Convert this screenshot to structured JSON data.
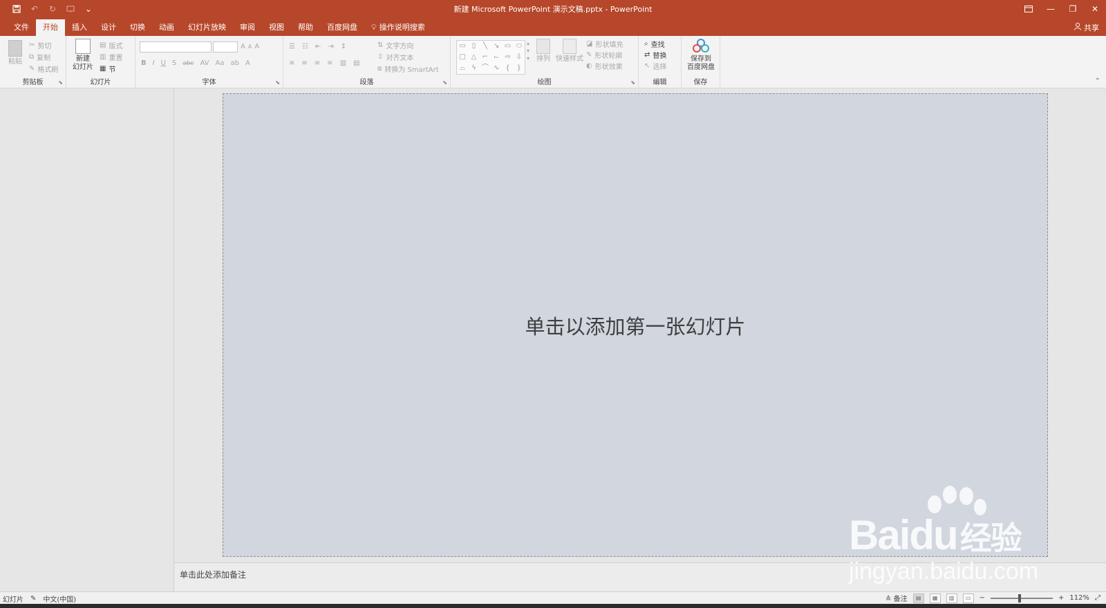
{
  "window": {
    "title": "新建 Microsoft PowerPoint 演示文稿.pptx  -  PowerPoint",
    "brand_color": "#b7472a"
  },
  "qat": {
    "save_icon": "save-icon",
    "undo_icon": "undo-icon",
    "redo_icon": "redo-icon",
    "presentation_icon": "from-beginning-icon",
    "customize_icon": "customize-qat-icon"
  },
  "tabs": [
    {
      "label": "文件"
    },
    {
      "label": "开始"
    },
    {
      "label": "插入"
    },
    {
      "label": "设计"
    },
    {
      "label": "切换"
    },
    {
      "label": "动画"
    },
    {
      "label": "幻灯片放映"
    },
    {
      "label": "审阅"
    },
    {
      "label": "视图"
    },
    {
      "label": "帮助"
    },
    {
      "label": "百度网盘"
    }
  ],
  "tell_me": "操作说明搜索",
  "share": "共享",
  "ribbon": {
    "clipboard": {
      "paste": "粘贴",
      "cut": "剪切",
      "copy": "复制",
      "format_painter": "格式刷",
      "label": "剪贴板"
    },
    "slides": {
      "new_slide_line1": "新建",
      "new_slide_line2": "幻灯片",
      "layout": "版式",
      "reset": "重置",
      "section": "节",
      "label": "幻灯片"
    },
    "font": {
      "label": "字体",
      "bold": "B",
      "italic": "I",
      "underline": "U",
      "shadow": "S",
      "strike": "abc",
      "spacing": "AV",
      "case": "Aa",
      "grow": "A",
      "shrink": "A",
      "clear": "A",
      "color": "A"
    },
    "paragraph": {
      "text_direction": "文字方向",
      "align_text": "对齐文本",
      "smartart": "转换为 SmartArt",
      "label": "段落"
    },
    "drawing": {
      "arrange": "排列",
      "quick_styles": "快速样式",
      "shape_fill": "形状填充",
      "shape_outline": "形状轮廓",
      "shape_effects": "形状效果",
      "label": "绘图"
    },
    "editing": {
      "find": "查找",
      "replace": "替换",
      "select": "选择",
      "label": "编辑"
    },
    "save": {
      "line1": "保存到",
      "line2": "百度网盘",
      "label": "保存"
    }
  },
  "slide": {
    "placeholder": "单击以添加第一张幻灯片"
  },
  "notes": {
    "placeholder": "单击此处添加备注"
  },
  "watermark": {
    "brand": "Bai",
    "brand2": "du",
    "brand3": "经验",
    "url": "jingyan.baidu.com"
  },
  "statusbar": {
    "slide": "幻灯片",
    "language": "中文(中国)",
    "notes": "备注",
    "zoom": "112%"
  }
}
